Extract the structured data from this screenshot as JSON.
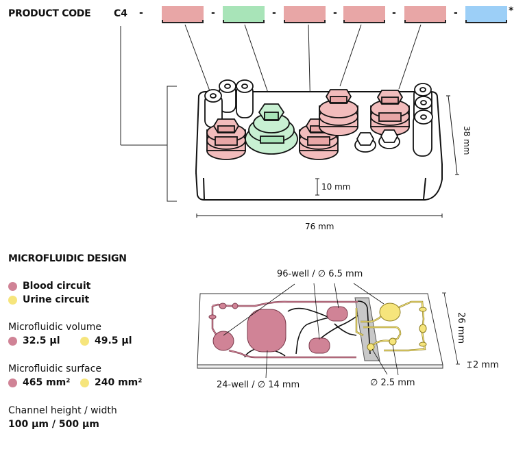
{
  "product_code": {
    "label": "PRODUCT CODE",
    "prefix": "C4",
    "separator": "-",
    "asterisk": "*",
    "slots": [
      {
        "color": "#e8a6a6",
        "role": "blood-compartment"
      },
      {
        "color": "#a8e4b8",
        "role": "tissue-compartment"
      },
      {
        "color": "#e8a6a6",
        "role": "blood-compartment"
      },
      {
        "color": "#e8a6a6",
        "role": "blood-compartment"
      },
      {
        "color": "#e8a6a6",
        "role": "blood-compartment"
      },
      {
        "color": "#9ccff7",
        "role": "urine-compartment"
      }
    ]
  },
  "chip_3d": {
    "dimensions": {
      "depth": "38 mm",
      "height": "10 mm",
      "width": "76 mm"
    },
    "colors": {
      "pink_fill": "#f2bcbc",
      "pink_dark": "#e8a6a6",
      "green_fill": "#c8f0d2",
      "green_dark": "#a8e4b8"
    }
  },
  "microfluidic_design": {
    "title": "MICROFLUIDIC DESIGN",
    "legend": [
      {
        "label": "Blood circuit",
        "color": "#d08396"
      },
      {
        "label": "Urine circuit",
        "color": "#f6e57c"
      }
    ],
    "volume": {
      "label": "Microfluidic volume",
      "blood": "32.5 µl",
      "urine": "49.5 µl"
    },
    "surface": {
      "label": "Microfluidic surface",
      "blood": "465 mm²",
      "urine": "240 mm²"
    },
    "channel": {
      "label": "Channel height / width",
      "value": "100 µm / 500 µm"
    }
  },
  "chip_layout": {
    "annotations": {
      "well96": "96-well / ∅ 6.5 mm",
      "well24": "24-well / ∅ 14 mm",
      "port": "∅ 2.5 mm",
      "depth": "26 mm",
      "thickness": "2 mm"
    },
    "colors": {
      "blood": "#d08396",
      "urine": "#f6e57c",
      "membrane": "#c8c8c8"
    }
  }
}
